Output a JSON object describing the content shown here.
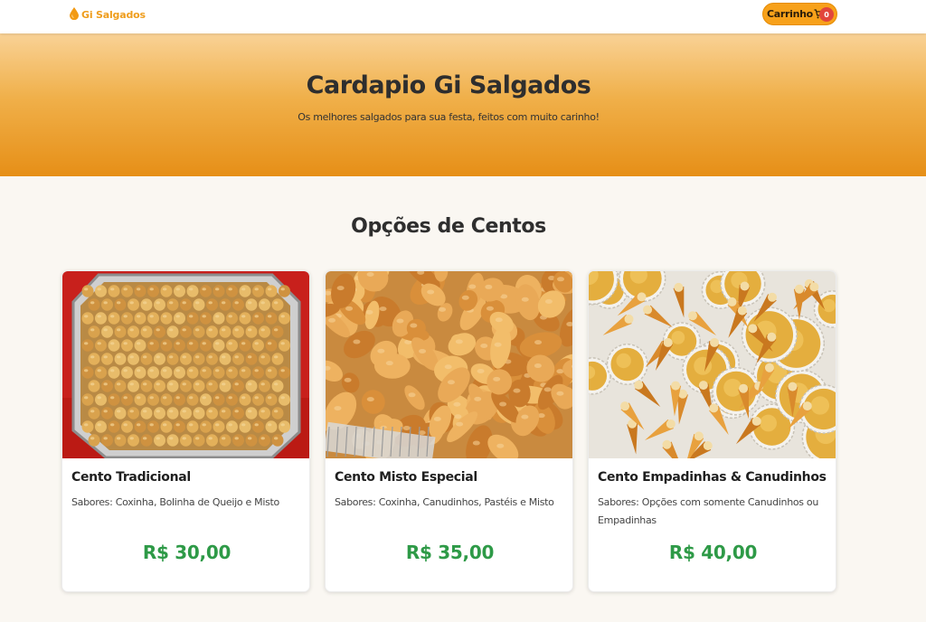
{
  "navbar": {
    "logo_text": "Gi Salgados",
    "cart_label": "Carrinho",
    "cart_count": "0"
  },
  "hero": {
    "title": "Cardapio Gi Salgados",
    "subtitle": "Os melhores salgados para sua festa, feitos com muito carinho!"
  },
  "section": {
    "title": "Opções de Centos"
  },
  "cards": [
    {
      "title": "Cento Tradicional",
      "description": "Sabores: Coxinha, Bolinha de Queijo e Misto",
      "price": "R$ 30,00"
    },
    {
      "title": "Cento Misto Especial",
      "description": "Sabores: Coxinha, Canudinhos, Pastéis e Misto",
      "price": "R$ 35,00"
    },
    {
      "title": "Cento Empadinhas & Canudinhos",
      "description": "Sabores: Opções com somente Canudinhos ou Empadinhas",
      "price": "R$ 40,00"
    }
  ],
  "icons": {
    "logo": "drop-icon",
    "cart": "shopping-cart-icon"
  },
  "colors": {
    "brand_orange": "#f7a11a",
    "price_green": "#2e9a47",
    "badge_red": "#e2463b"
  }
}
